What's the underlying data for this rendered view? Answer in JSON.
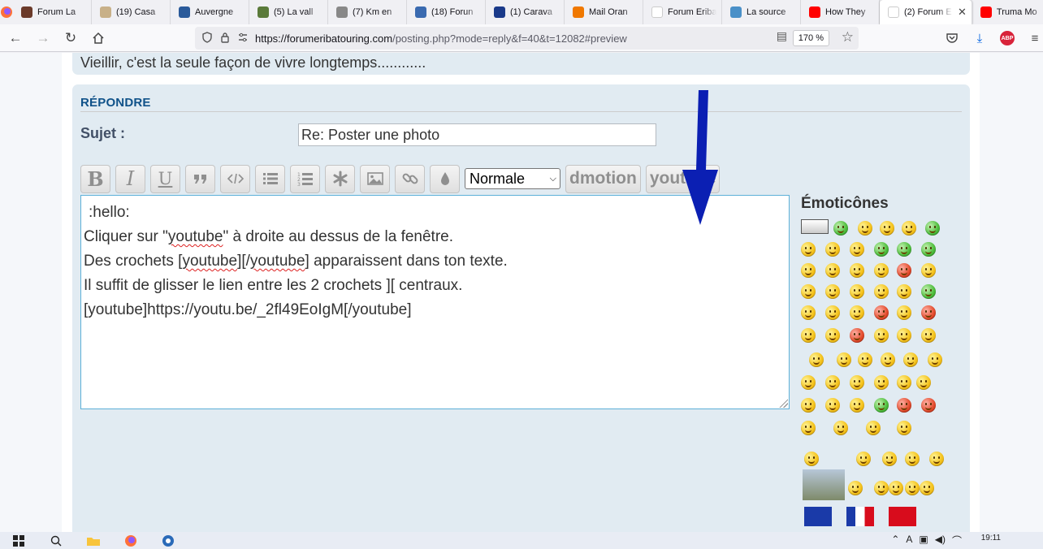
{
  "browser": {
    "tabs": [
      {
        "label": "Forum La",
        "color": "#6b3a2a"
      },
      {
        "label": "(19) Casa",
        "color": "#c8b088"
      },
      {
        "label": "Auvergne",
        "color": "#2a5a9a"
      },
      {
        "label": "(5) La vall",
        "color": "#5a7a3a"
      },
      {
        "label": "(7) Km en",
        "color": "#888888"
      },
      {
        "label": "(18) Forun",
        "color": "#3a6ab0"
      },
      {
        "label": "(1) Carava",
        "color": "#1a3a8a"
      },
      {
        "label": "Mail Oran",
        "color": "#f07800"
      },
      {
        "label": "Forum Eriba T",
        "color": "#ffffff"
      },
      {
        "label": "La source",
        "color": "#4a90c8"
      },
      {
        "label": "How They",
        "color": "#ff0000"
      },
      {
        "label": "(2) Forum E",
        "color": "#ffffff",
        "active": true
      },
      {
        "label": "Truma Mo",
        "color": "#ff0000"
      }
    ],
    "close_tab_glyph": "✕",
    "new_tab_glyph": "+",
    "url_host": "https://forumeribatouring.com",
    "url_path": "/posting.php?mode=reply&f=40&t=12082#preview",
    "zoom": "170 %",
    "abp_label": "ABP"
  },
  "page": {
    "signature": "Vieillir, c'est la seule façon de vivre longtemps............",
    "reply_heading": "RÉPONDRE",
    "subject_label": "Sujet :",
    "subject_value": "Re: Poster une photo",
    "toolbar": {
      "bold": "B",
      "italic": "I",
      "underline": "U",
      "font_size_selected": "Normale",
      "dmotion_label": "dmotion",
      "youtube_label": "youtube"
    },
    "editor_lines": [
      ":hello:",
      "",
      "Cliquer sur \"youtube\" à droite au dessus de la fenêtre.",
      "Des crochets [youtube][/youtube] apparaissent dans ton texte.",
      "Il suffit de glisser le lien entre les 2 crochets ][ centraux.",
      "[youtube]https://youtu.be/_2fl49EoIgM[/youtube]"
    ],
    "smilies_title": "Émoticônes",
    "accent_color": "#105289",
    "arrow_color": "#0b1fb3"
  },
  "taskbar": {
    "clock": "19:11"
  }
}
